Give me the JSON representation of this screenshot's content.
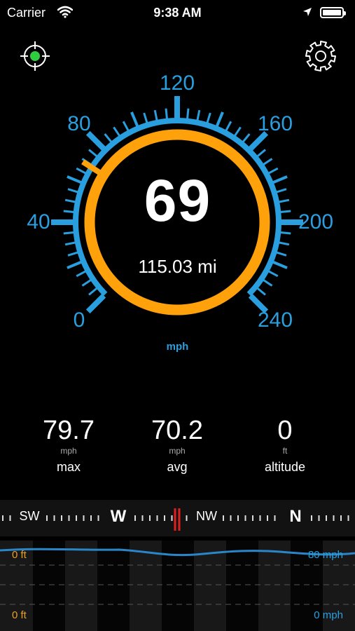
{
  "status_bar": {
    "carrier": "Carrier",
    "time": "9:38 AM"
  },
  "speedometer": {
    "speed": "69",
    "distance": "115.03 mi",
    "unit": "mph",
    "scale_labels": [
      "0",
      "40",
      "80",
      "120",
      "160",
      "200",
      "240"
    ],
    "speed_fraction": 0.2875
  },
  "stats": [
    {
      "value": "79.7",
      "unit": "mph",
      "label": "max"
    },
    {
      "value": "70.2",
      "unit": "mph",
      "label": "avg"
    },
    {
      "value": "0",
      "unit": "ft",
      "label": "altitude"
    }
  ],
  "compass": {
    "directions": [
      "SW",
      "W",
      "NW",
      "N"
    ]
  },
  "graph": {
    "altitude_top": "0 ft",
    "altitude_bottom": "0 ft",
    "speed_top": "80 mph",
    "speed_bottom": "0 mph"
  },
  "colors": {
    "accent": "#2a9fdf",
    "speed": "#ffa10a",
    "gps": "#2ecc40",
    "needle": "#e02020"
  },
  "icons": {
    "gps": "crosshair-icon",
    "settings": "gear-icon"
  }
}
